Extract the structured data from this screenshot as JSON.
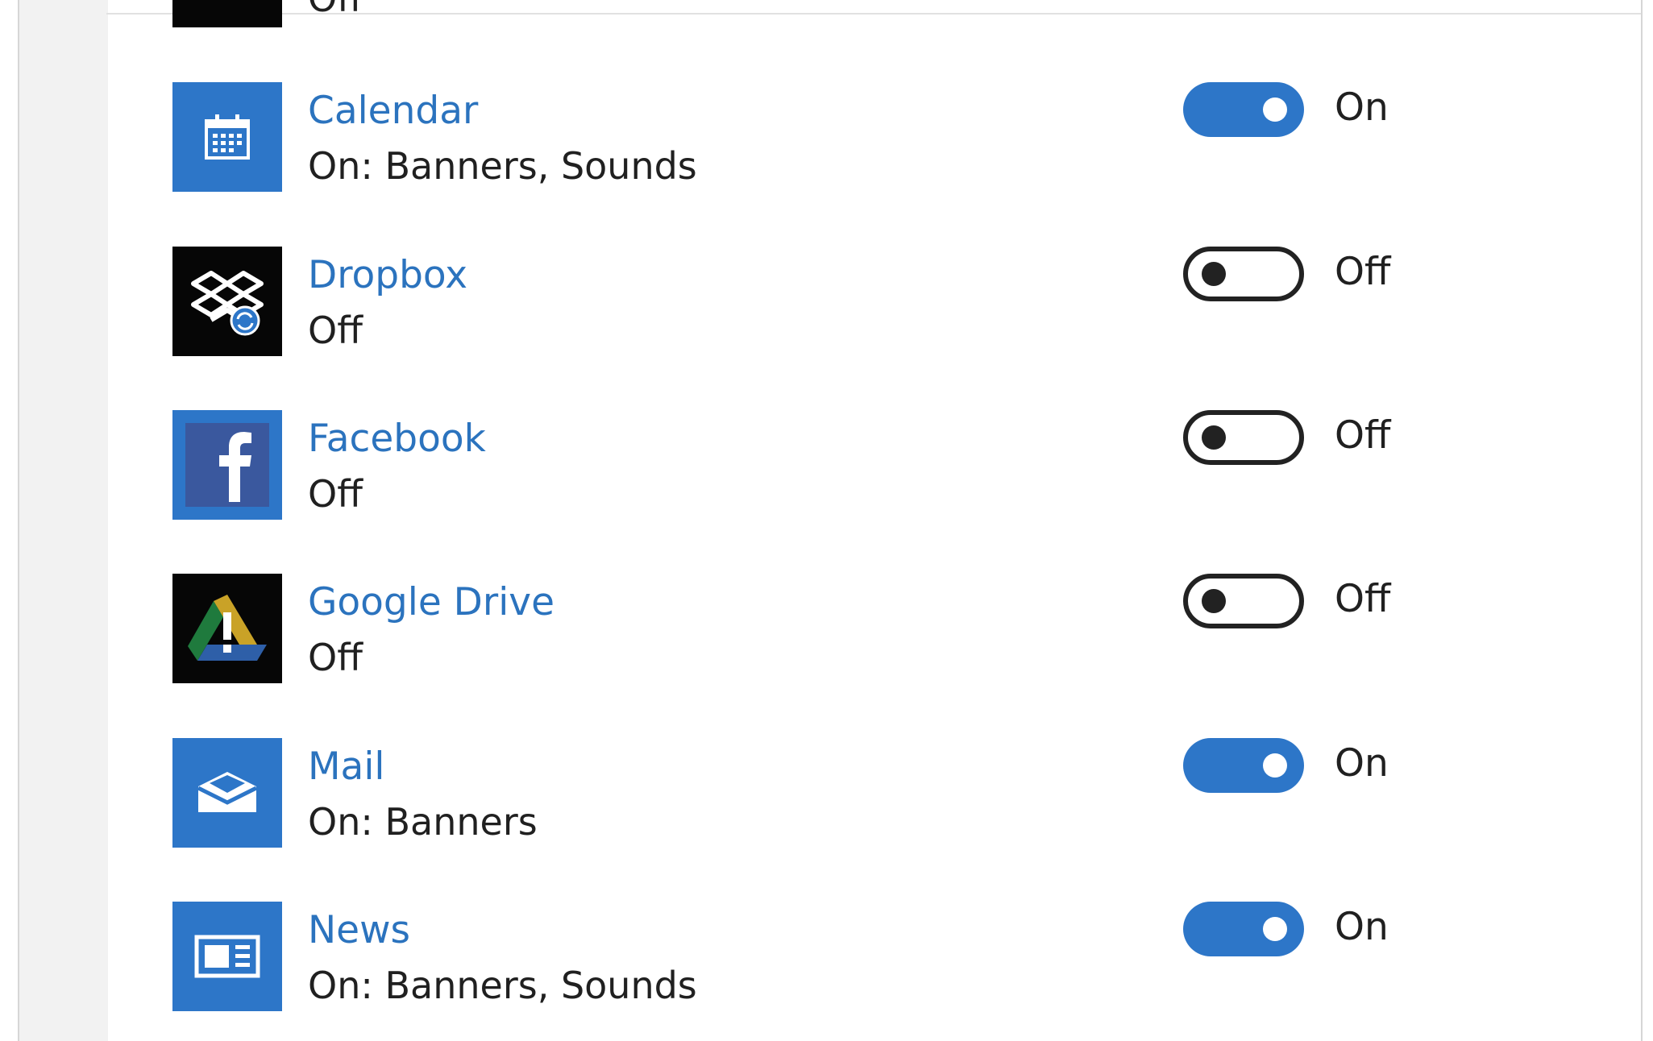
{
  "partial_row": {
    "status": "Off"
  },
  "apps": [
    {
      "name": "Calendar",
      "status": "On: Banners, Sounds",
      "toggle": "On",
      "icon": "calendar-icon"
    },
    {
      "name": "Dropbox",
      "status": "Off",
      "toggle": "Off",
      "icon": "dropbox-icon"
    },
    {
      "name": "Facebook",
      "status": "Off",
      "toggle": "Off",
      "icon": "facebook-icon"
    },
    {
      "name": "Google Drive",
      "status": "Off",
      "toggle": "Off",
      "icon": "google-drive-icon"
    },
    {
      "name": "Mail",
      "status": "On: Banners",
      "toggle": "On",
      "icon": "mail-icon"
    },
    {
      "name": "News",
      "status": "On: Banners, Sounds",
      "toggle": "On",
      "icon": "news-icon"
    }
  ],
  "colors": {
    "accent": "#2d76c8",
    "link": "#2b73be",
    "text": "#202020",
    "toggle_off_border": "#222222"
  }
}
